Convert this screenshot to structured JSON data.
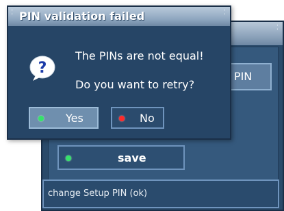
{
  "background_window": {
    "partial_button_label": "e PIN",
    "save_label": "save",
    "status_text": "change Setup PIN (ok)"
  },
  "dialog": {
    "title": "PIN validation failed",
    "message_line1": "The PINs are not equal!",
    "message_line2": "Do you want to retry?",
    "yes_label": "Yes",
    "no_label": "No"
  },
  "icons": {
    "question": "question-icon",
    "green_indicator": "green-dot-icon",
    "red_indicator": "red-dot-icon"
  },
  "colors": {
    "panel_blue": "#264566",
    "highlight_blue": "#6f8fae",
    "green_key": "#35e26a",
    "red_key": "#ff2a2a"
  }
}
